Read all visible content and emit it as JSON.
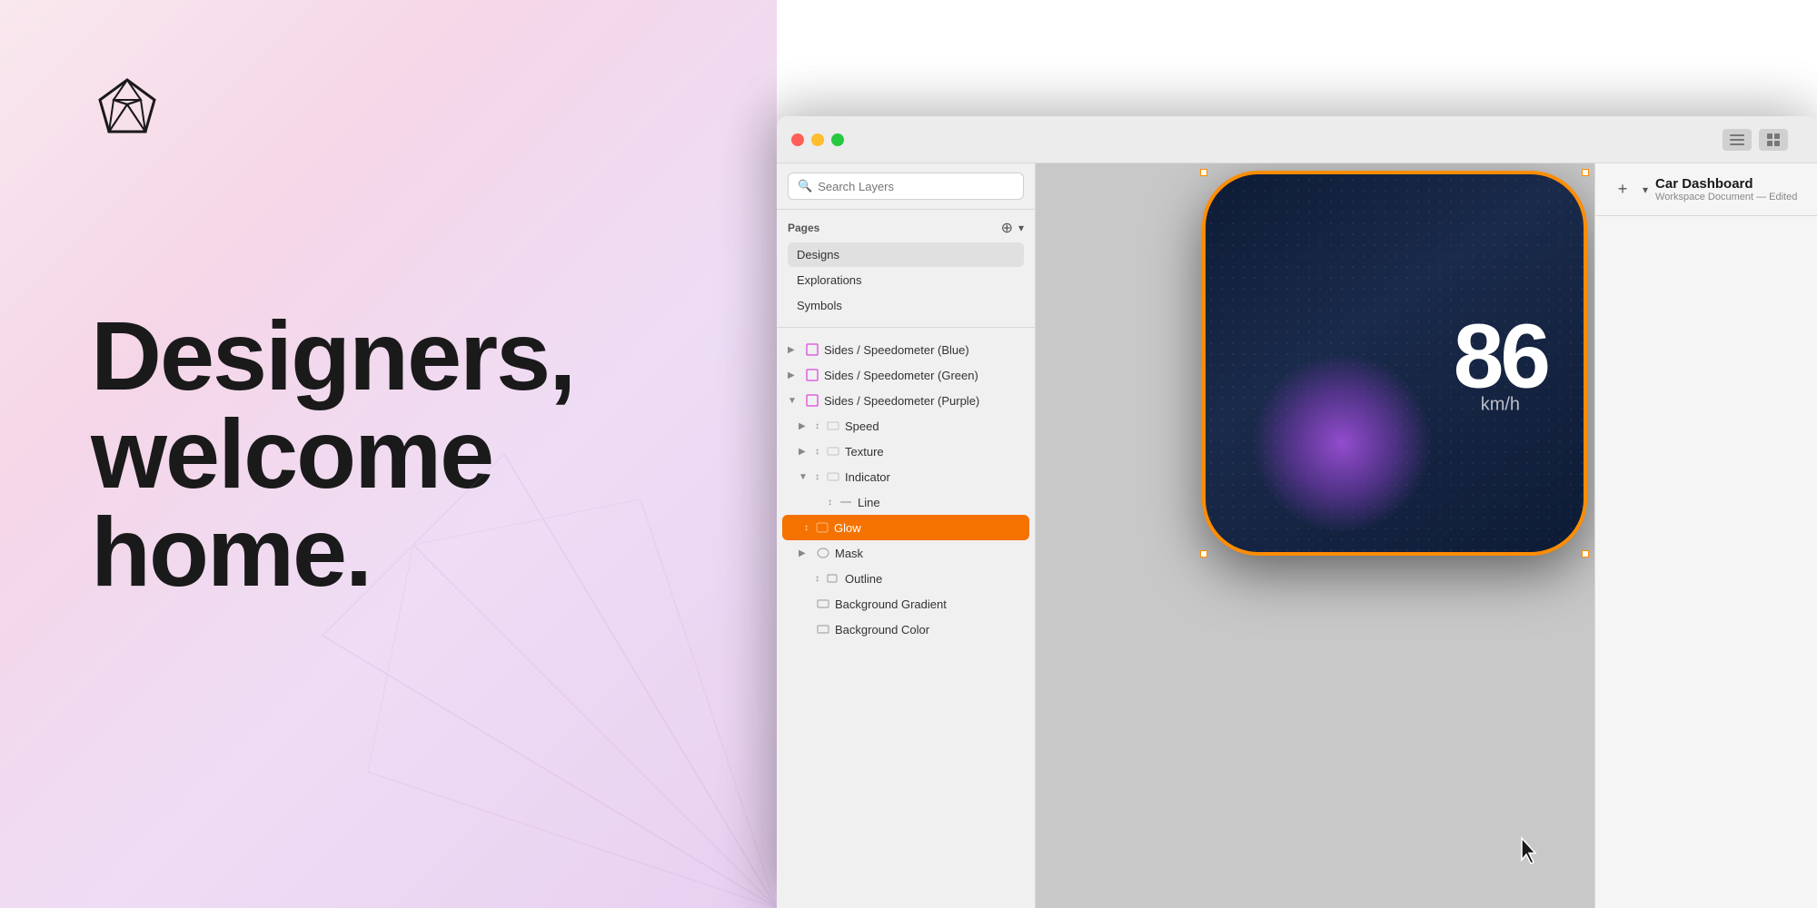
{
  "left_panel": {
    "hero_line1": "Designers,",
    "hero_line2": "welcome",
    "hero_line3": "home."
  },
  "app": {
    "title": "Car Dashboard",
    "subtitle": "Workspace Document — Edited",
    "traffic_lights": {
      "red": "#ff5f57",
      "yellow": "#ffbd2e",
      "green": "#28c840"
    }
  },
  "search": {
    "placeholder": "Search Layers"
  },
  "pages": {
    "label": "Pages",
    "add_label": "+",
    "chevron_label": "▾",
    "items": [
      {
        "name": "Designs",
        "active": true
      },
      {
        "name": "Explorations",
        "active": false
      },
      {
        "name": "Symbols",
        "active": false
      }
    ]
  },
  "layers": [
    {
      "name": "Sides / Speedometer (Blue)",
      "indent": 0,
      "expanded": false,
      "icon": "artboard",
      "chevron": "▶"
    },
    {
      "name": "Sides / Speedometer (Green)",
      "indent": 0,
      "expanded": false,
      "icon": "artboard",
      "chevron": "▶"
    },
    {
      "name": "Sides / Speedometer (Purple)",
      "indent": 0,
      "expanded": true,
      "icon": "artboard",
      "chevron": "▼"
    },
    {
      "name": "Speed",
      "indent": 1,
      "expanded": false,
      "icon": "group",
      "chevron": "▶"
    },
    {
      "name": "Texture",
      "indent": 1,
      "expanded": false,
      "icon": "group",
      "chevron": "▶"
    },
    {
      "name": "Indicator",
      "indent": 1,
      "expanded": true,
      "icon": "group",
      "chevron": "▼"
    },
    {
      "name": "Line",
      "indent": 2,
      "expanded": false,
      "icon": "line",
      "chevron": ""
    },
    {
      "name": "Glow",
      "indent": 2,
      "expanded": false,
      "icon": "oval",
      "chevron": "",
      "selected": true
    },
    {
      "name": "Mask",
      "indent": 1,
      "expanded": false,
      "icon": "oval",
      "chevron": "▶"
    },
    {
      "name": "Outline",
      "indent": 1,
      "expanded": false,
      "icon": "combined",
      "chevron": ""
    },
    {
      "name": "Background Gradient",
      "indent": 1,
      "expanded": false,
      "icon": "rect",
      "chevron": ""
    },
    {
      "name": "Background Color",
      "indent": 1,
      "expanded": false,
      "icon": "rect",
      "chevron": ""
    }
  ],
  "dashboard": {
    "speed": "86",
    "unit": "km/h"
  },
  "bottom": {
    "bg_color_label": "Background Color"
  }
}
